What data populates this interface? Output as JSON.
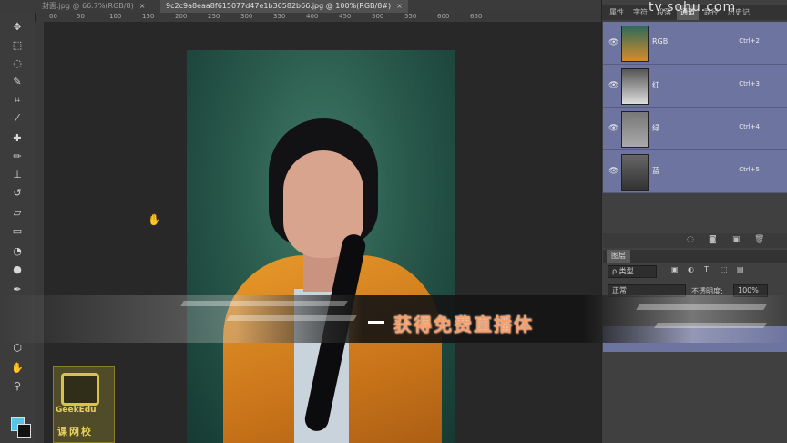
{
  "tabs": [
    {
      "label": "封面.jpg @ 66.7%(RGB/8)",
      "close": "×",
      "active": false
    },
    {
      "label": "9c2c9a8eaa8f615077d47e1b36582b66.jpg @ 100%(RGB/8#)",
      "close": "×",
      "active": true
    }
  ],
  "ruler": [
    "00",
    "50",
    "100",
    "150",
    "200",
    "250",
    "300",
    "350",
    "400",
    "450",
    "500",
    "550",
    "600",
    "650"
  ],
  "tools": [
    "move-tool",
    "marquee-tool",
    "lasso-tool",
    "quick-select-tool",
    "crop-tool",
    "eyedropper-tool",
    "healing-brush-tool",
    "brush-tool",
    "clone-stamp-tool",
    "history-brush-tool",
    "eraser-tool",
    "gradient-tool",
    "blur-tool",
    "dodge-tool",
    "pen-tool",
    "shape-tool",
    "hand-tool",
    "zoom-tool"
  ],
  "panel_tabs": [
    "属性",
    "字符",
    "段落",
    "通道",
    "路径",
    "历史记"
  ],
  "watermark": "tv.sohu.com",
  "channels": [
    {
      "name": "RGB",
      "shortcut": "Ctrl+2"
    },
    {
      "name": "红",
      "shortcut": "Ctrl+3"
    },
    {
      "name": "绿",
      "shortcut": "Ctrl+4"
    },
    {
      "name": "蓝",
      "shortcut": "Ctrl+5"
    }
  ],
  "layers": {
    "tab": "图层",
    "filter_label": "ρ 类型",
    "blend_mode": "正常",
    "opacity_label": "不透明度:",
    "opacity_value": "100%"
  },
  "banner_text": "获得免费直播体",
  "logo": {
    "line1": "GeekEdu",
    "line2": "课网校"
  },
  "colors": {
    "foreground": "#52c6e8",
    "background": "#111111",
    "selection": "#6e74a0"
  }
}
